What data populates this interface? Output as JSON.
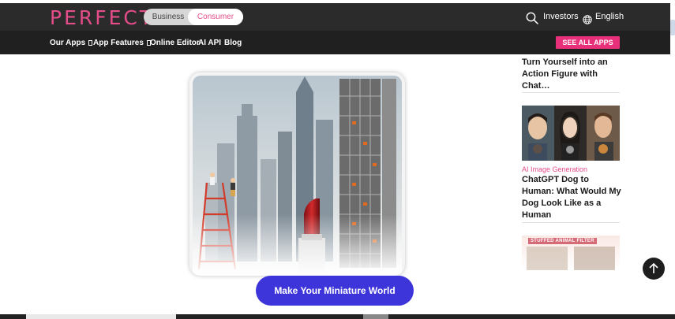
{
  "header": {
    "logo": "PERFECT",
    "toggle": {
      "business": "Business",
      "consumer": "Consumer"
    },
    "investors": "Investors",
    "language": "English"
  },
  "nav": {
    "items": [
      {
        "label": "Our Apps"
      },
      {
        "label": "App Features"
      },
      {
        "label": "Online Editor"
      },
      {
        "label": "AI API"
      },
      {
        "label": "Blog"
      }
    ],
    "see_all": "SEE ALL APPS"
  },
  "main": {
    "cta": "Make Your Miniature World"
  },
  "sidebar": {
    "article1_title": "Turn Yourself into an Action Figure with Chat…",
    "article2_category": "AI Image Generation",
    "article2_title": "ChatGPT Dog to Human: What Would My Dog Look Like as a Human",
    "article3_thumb_label": "STUFFED ANIMAL FILTER"
  },
  "colors": {
    "brand_pink": "#e44d8a",
    "see_all_bg": "#e8307a",
    "cta_bg": "#3d35d9",
    "header_bg": "#2b2b2b",
    "nav_bg": "#202020"
  }
}
